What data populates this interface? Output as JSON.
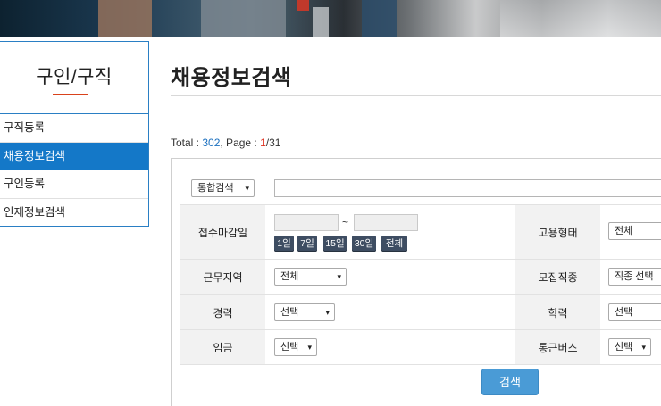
{
  "sidebar": {
    "title": "구인/구직",
    "items": [
      {
        "label": "구직등록"
      },
      {
        "label": "채용정보검색"
      },
      {
        "label": "구인등록"
      },
      {
        "label": "인재정보검색"
      }
    ],
    "active_index": 1
  },
  "main": {
    "title": "채용정보검색",
    "total": {
      "prefix": "Total : ",
      "count": "302",
      "mid": ", Page : ",
      "current": "1",
      "sep": "/",
      "pages": "31"
    }
  },
  "search": {
    "scope_select": "통합검색",
    "keyword_value": "",
    "labels": {
      "deadline": "접수마감일",
      "employment_type": "고용형태",
      "region": "근무지역",
      "job_type": "모집직종",
      "experience": "경력",
      "education": "학력",
      "wage": "임금",
      "bus": "통근버스"
    },
    "date_from": "",
    "tilde": "~",
    "date_to": "",
    "day_buttons": [
      "1일",
      "7일",
      "15일",
      "30일",
      "전체"
    ],
    "employment_type_value": "전체",
    "region_value": "전체",
    "job_type_value": "직종 선택",
    "experience_value": "선택",
    "education_value": "선택",
    "wage_value": "선택",
    "bus_value": "선택",
    "submit_label": "검색"
  },
  "colors": {
    "accent": "#1478c8",
    "day_button": "#3e4d62",
    "search_button": "#4a9bd6",
    "current_page": "#e0301e"
  }
}
